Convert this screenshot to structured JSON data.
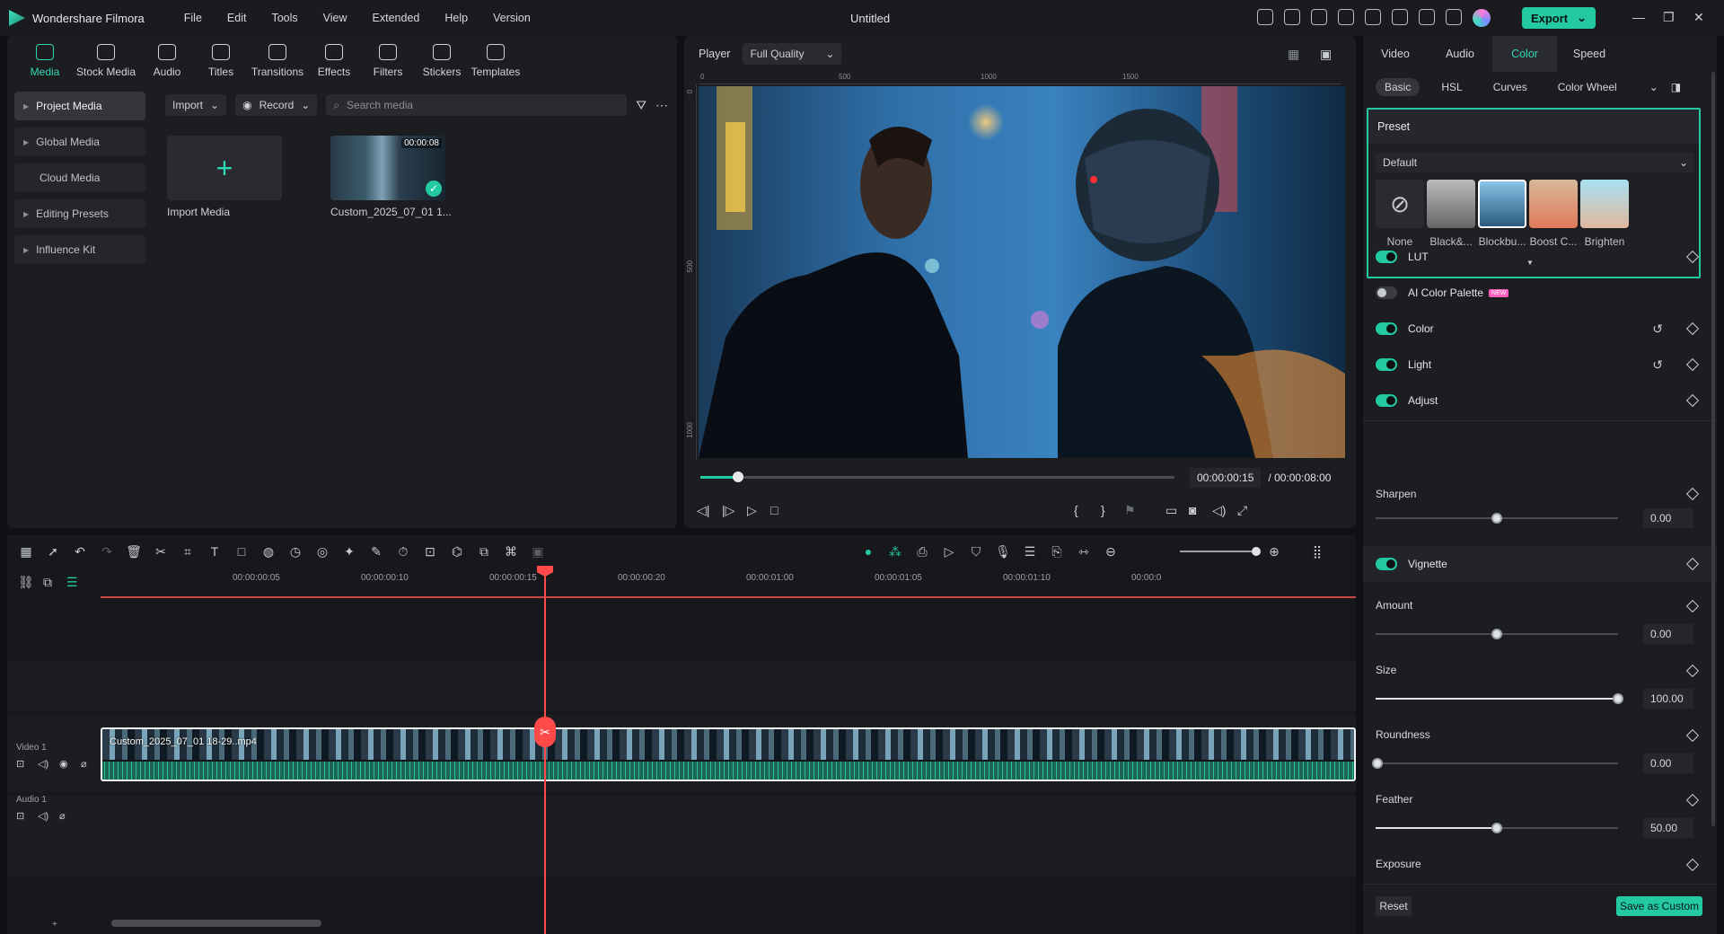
{
  "app": {
    "name": "Wondershare Filmora",
    "window_title": "Untitled"
  },
  "menu": [
    "File",
    "Edit",
    "Tools",
    "View",
    "Extended",
    "Help",
    "Version"
  ],
  "export_label": "Export",
  "toolstrip": [
    "Media",
    "Stock Media",
    "Audio",
    "Titles",
    "Transitions",
    "Effects",
    "Filters",
    "Stickers",
    "Templates"
  ],
  "sidenav": [
    "Project Media",
    "Global Media",
    "Cloud Media",
    "Editing Presets",
    "Influence Kit"
  ],
  "mediabar": {
    "import": "Import",
    "record": "Record",
    "search_placeholder": "Search media"
  },
  "media": {
    "import_label": "Import Media",
    "clip_name": "Custom_2025_07_01 1...",
    "clip_duration": "00:00:08"
  },
  "player": {
    "label": "Player",
    "quality": "Full Quality",
    "ruler": [
      "0",
      "500",
      "1000",
      "1500"
    ],
    "vruler": [
      "0",
      "500",
      "1000"
    ],
    "current_time": "00:00:00:15",
    "total_time": "/ 00:00:08:00",
    "progress": 0.08
  },
  "timeline": {
    "ticks": [
      "00:00:00:05",
      "00:00:00:10",
      "00:00:00:15",
      "00:00:00:20",
      "00:00:01:00",
      "00:00:01:05",
      "00:00:01:10",
      "00:00:0"
    ],
    "video_track": "Video 1",
    "audio_track": "Audio 1",
    "clip_name": "Custom_2025_07_01 18-29..mp4"
  },
  "right_panel": {
    "tabs": [
      "Video",
      "Audio",
      "Color",
      "Speed"
    ],
    "active_tab": "Color",
    "subtabs": [
      "Basic",
      "HSL",
      "Curves",
      "Color Wheel"
    ],
    "preset": {
      "header": "Preset",
      "dropdown": "Default",
      "items": [
        "None",
        "Black&...",
        "Blockbu...",
        "Boost C...",
        "Brighten"
      ]
    },
    "sections": [
      {
        "label": "LUT",
        "on": true
      },
      {
        "label": "AI Color Palette",
        "on": false,
        "badge": "NEW"
      },
      {
        "label": "Color",
        "on": true
      },
      {
        "label": "Light",
        "on": true
      },
      {
        "label": "Adjust",
        "on": true
      }
    ],
    "sharpen": {
      "label": "Sharpen",
      "value": "0.00"
    },
    "vignette": {
      "label": "Vignette",
      "on": true
    },
    "amount": {
      "label": "Amount",
      "value": "0.00"
    },
    "size": {
      "label": "Size",
      "value": "100.00"
    },
    "roundness": {
      "label": "Roundness",
      "value": "0.00"
    },
    "feather": {
      "label": "Feather",
      "value": "50.00"
    },
    "exposure": {
      "label": "Exposure"
    },
    "reset": "Reset",
    "save": "Save as Custom"
  },
  "colors": {
    "accent": "#22c9a2",
    "playhead": "#ff4a4a"
  }
}
